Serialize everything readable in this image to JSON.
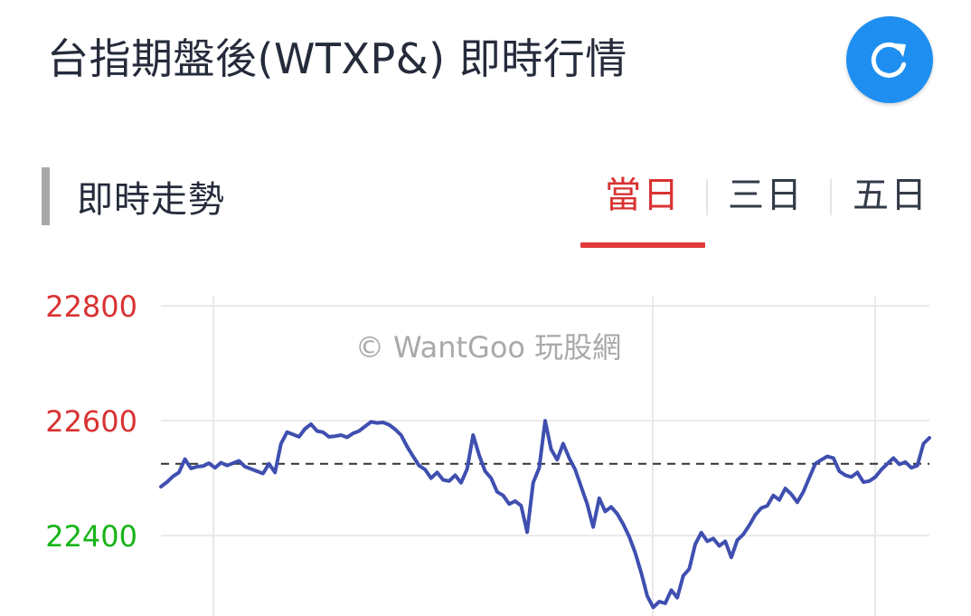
{
  "header": {
    "title": "台指期盤後(WTXP&) 即時行情"
  },
  "icons": {
    "refresh": "refresh-icon"
  },
  "colors": {
    "accent_blue": "#1e8ff0",
    "active_tab_red": "#d93232",
    "series_line": "#3f4fb0",
    "tick_above_reference": "#d93232",
    "tick_below_reference": "#17b417"
  },
  "section": {
    "title": "即時走勢"
  },
  "tabs": [
    {
      "label": "當日",
      "active": true
    },
    {
      "label": "三日",
      "active": false
    },
    {
      "label": "五日",
      "active": false
    }
  ],
  "chart_data": {
    "type": "line",
    "watermark": "© WantGoo 玩股網",
    "ylim": [
      22260,
      22860
    ],
    "y_ticks": [
      22800,
      22600,
      22400
    ],
    "y_tick_labels": [
      "22800",
      "22600",
      "22400"
    ],
    "reference_line": 22525,
    "grid": true,
    "values": [
      22485,
      22493,
      22503,
      22510,
      22533,
      22517,
      22520,
      22521,
      22526,
      22518,
      22527,
      22522,
      22526,
      22530,
      22520,
      22516,
      22512,
      22508,
      22525,
      22510,
      22560,
      22580,
      22576,
      22572,
      22586,
      22594,
      22582,
      22580,
      22572,
      22573,
      22575,
      22571,
      22578,
      22582,
      22590,
      22598,
      22596,
      22597,
      22593,
      22585,
      22575,
      22555,
      22538,
      22522,
      22515,
      22500,
      22510,
      22497,
      22495,
      22505,
      22492,
      22516,
      22575,
      22540,
      22512,
      22500,
      22476,
      22470,
      22455,
      22460,
      22452,
      22406,
      22492,
      22518,
      22600,
      22550,
      22532,
      22560,
      22535,
      22515,
      22485,
      22455,
      22415,
      22465,
      22442,
      22450,
      22438,
      22420,
      22398,
      22370,
      22335,
      22295,
      22275,
      22285,
      22282,
      22305,
      22292,
      22330,
      22342,
      22385,
      22405,
      22390,
      22395,
      22382,
      22390,
      22362,
      22392,
      22402,
      22418,
      22436,
      22448,
      22452,
      22470,
      22462,
      22482,
      22472,
      22458,
      22476,
      22501,
      22525,
      22532,
      22538,
      22535,
      22512,
      22505,
      22502,
      22510,
      22493,
      22495,
      22502,
      22515,
      22525,
      22535,
      22524,
      22528,
      22518,
      22522,
      22560,
      22570
    ]
  }
}
